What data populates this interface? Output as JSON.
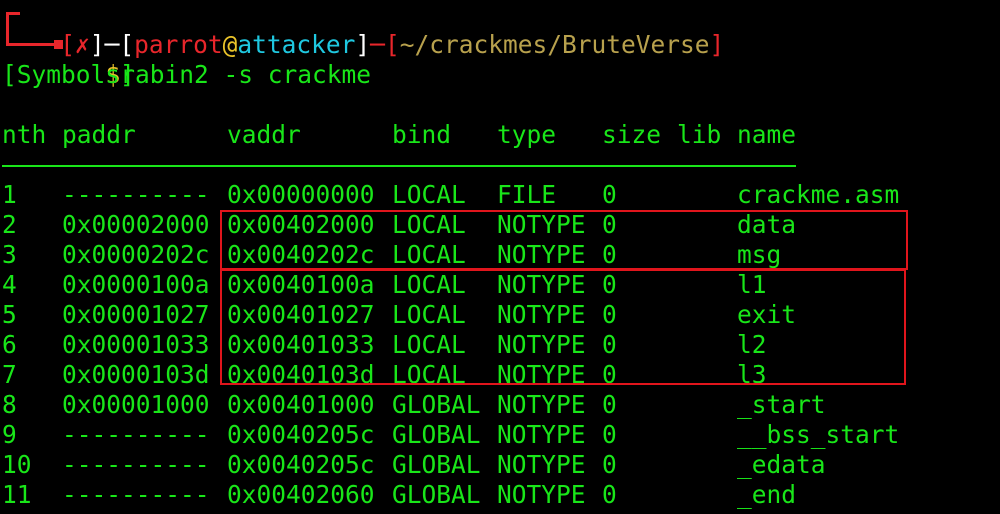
{
  "prompt": {
    "open_bracket": "[",
    "status_mark": "✗",
    "close_bracket": "]",
    "dash": "─",
    "user": "parrot",
    "at": "@",
    "host": "attacker",
    "path": "~/crackmes/BruteVerse",
    "dollar": "$",
    "command": "rabin2 -s crackme"
  },
  "output": {
    "section": "[Symbols]",
    "headers": [
      "nth",
      "paddr",
      "vaddr",
      "bind",
      "type",
      "size",
      "lib",
      "name"
    ],
    "rows": [
      [
        "1",
        "----------",
        "0x00000000",
        "LOCAL",
        "FILE",
        "0",
        "",
        "crackme.asm"
      ],
      [
        "2",
        "0x00002000",
        "0x00402000",
        "LOCAL",
        "NOTYPE",
        "0",
        "",
        "data"
      ],
      [
        "3",
        "0x0000202c",
        "0x0040202c",
        "LOCAL",
        "NOTYPE",
        "0",
        "",
        "msg"
      ],
      [
        "4",
        "0x0000100a",
        "0x0040100a",
        "LOCAL",
        "NOTYPE",
        "0",
        "",
        "l1"
      ],
      [
        "5",
        "0x00001027",
        "0x00401027",
        "LOCAL",
        "NOTYPE",
        "0",
        "",
        "exit"
      ],
      [
        "6",
        "0x00001033",
        "0x00401033",
        "LOCAL",
        "NOTYPE",
        "0",
        "",
        "l2"
      ],
      [
        "7",
        "0x0000103d",
        "0x0040103d",
        "LOCAL",
        "NOTYPE",
        "0",
        "",
        "l3"
      ],
      [
        "8",
        "0x00001000",
        "0x00401000",
        "GLOBAL",
        "NOTYPE",
        "0",
        "",
        "_start"
      ],
      [
        "9",
        "----------",
        "0x0040205c",
        "GLOBAL",
        "NOTYPE",
        "0",
        "",
        "__bss_start"
      ],
      [
        "10",
        "----------",
        "0x0040205c",
        "GLOBAL",
        "NOTYPE",
        "0",
        "",
        "_edata"
      ],
      [
        "11",
        "----------",
        "0x00402060",
        "GLOBAL",
        "NOTYPE",
        "0",
        "",
        "_end"
      ]
    ]
  },
  "colors": {
    "background": "#000000",
    "text": "#19e619",
    "prompt_red": "#e8262b",
    "prompt_cyan": "#1fc8e0",
    "prompt_yellow": "#e9c32a",
    "highlight_box": "#e0151c"
  }
}
